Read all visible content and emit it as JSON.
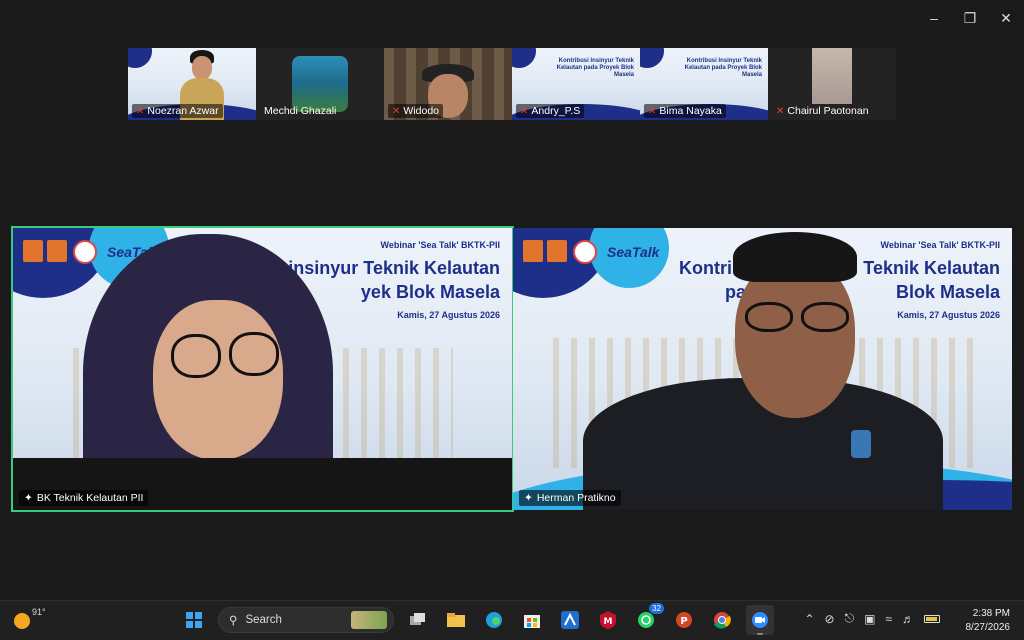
{
  "window": {
    "minimize": "–",
    "maximize": "❐",
    "close": "✕"
  },
  "participants": [
    {
      "name": "Noezran Azwar",
      "muted": true
    },
    {
      "name": "Mechdi Ghazali",
      "muted": false
    },
    {
      "name": "Widodo",
      "muted": true
    },
    {
      "name": "Andry_P.S",
      "muted": true
    },
    {
      "name": "Bima Nayaka",
      "muted": true
    },
    {
      "name": "Chairul Paotonan",
      "muted": true
    }
  ],
  "slide": {
    "header": "Webinar 'Sea Talk' BKTK-PII",
    "title_line1": "Kontribusi Insinyur Teknik Kelautan",
    "title_line2": "pada Proyek Blok Masela",
    "date": "Kamis, 27 Agustus 2026",
    "brand": "SeaTalk",
    "partial_left_l1": "K",
    "partial_left_l1b": "insinyur Teknik Kelautan",
    "partial_left_l2": "yek Blok Masela",
    "partial_right_l1a": "Kontribu",
    "partial_right_l1b": "Teknik Kelautan",
    "partial_right_l2a": "pa",
    "partial_right_l2b": "Blok Masela"
  },
  "main_tiles": [
    {
      "name": "BK Teknik Kelautan PII",
      "active": true
    },
    {
      "name": "Herman Pratikno",
      "active": false
    }
  ],
  "taskbar": {
    "temperature": "91°",
    "search_placeholder": "Search",
    "whatsapp_badge": "32",
    "time": "2:38 PM",
    "date": "8/27/2026"
  },
  "colors": {
    "accent_green": "#3cc97a",
    "slide_navy": "#1e2f8a",
    "slide_cyan": "#2fb2e8",
    "muted_red": "#e23b3b"
  }
}
